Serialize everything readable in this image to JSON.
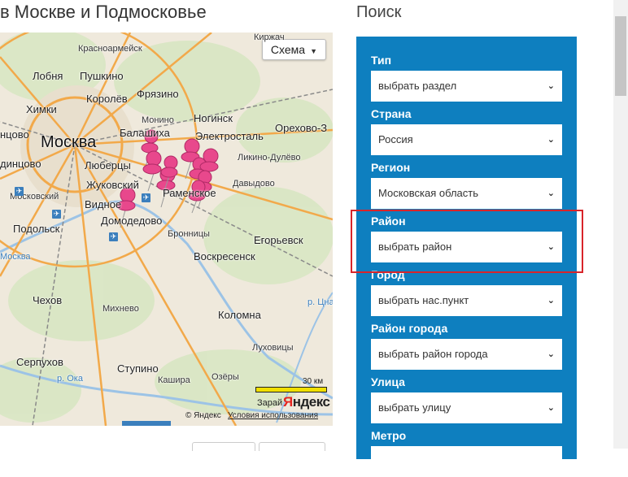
{
  "page": {
    "title": "в Москве и Подмосковье"
  },
  "map": {
    "scheme_label": "Схема",
    "cities": {
      "moskva": "Москва",
      "lobnya": "Лобня",
      "pushkino": "Пушкино",
      "khimki": "Химки",
      "korolev": "Королёв",
      "fryazino": "Фрязино",
      "noginsk": "Ногинск",
      "monino": "Монино",
      "balashikha": "Балашиха",
      "elektrostal": "Электросталь",
      "orekhovo": "Орехово-З",
      "krasnoarmeysk": "Красноармейск",
      "kirzhach": "Киржач",
      "lyubertsy": "Люберцы",
      "zhukovsky": "Жуковский",
      "vidnoe": "Видное",
      "ramenskoe": "Раменское",
      "likino": "Ликино-Дулёво",
      "davydovo": "Давыдово",
      "domodedovo": "Домодедово",
      "podolsk": "Подольск",
      "bronnitsy": "Бронницы",
      "egoryevsk": "Егорьевск",
      "voskresensk": "Воскресенск",
      "chekhov": "Чехов",
      "mikhnevo": "Михнево",
      "kolomna": "Коломна",
      "serpukhov": "Серпухов",
      "stupino": "Ступино",
      "lukhovitsy": "Луховицы",
      "kashira": "Кашира",
      "ozery": "Озёры",
      "zaraysk": "Зарай",
      "moskovsky": "Московский",
      "dintsovo": "динцово",
      "ntsovo": "нцово"
    },
    "river_moscow": "Москва",
    "river_oka": "р. Ока",
    "river_tsna": "р. Цна",
    "scale": "30 км",
    "logo_ya": "Я",
    "logo_ndex": "ндекс",
    "copyright": "© Яндекс",
    "terms": "Условия использования"
  },
  "search": {
    "heading": "Поиск",
    "fields": [
      {
        "label": "Тип",
        "value": "выбрать раздел"
      },
      {
        "label": "Страна",
        "value": "Россия"
      },
      {
        "label": "Регион",
        "value": "Московская область"
      },
      {
        "label": "Район",
        "value": "выбрать район"
      },
      {
        "label": "Город",
        "value": "выбрать нас.пункт"
      },
      {
        "label": "Район города",
        "value": "выбрать район города"
      },
      {
        "label": "Улица",
        "value": "выбрать улицу"
      },
      {
        "label": "Метро",
        "value": ""
      }
    ],
    "chevron": "❯"
  },
  "colors": {
    "panel": "#0e7fbf",
    "pin": "#e8488c",
    "highlight": "#d8242a",
    "road": "#f2a94a"
  }
}
